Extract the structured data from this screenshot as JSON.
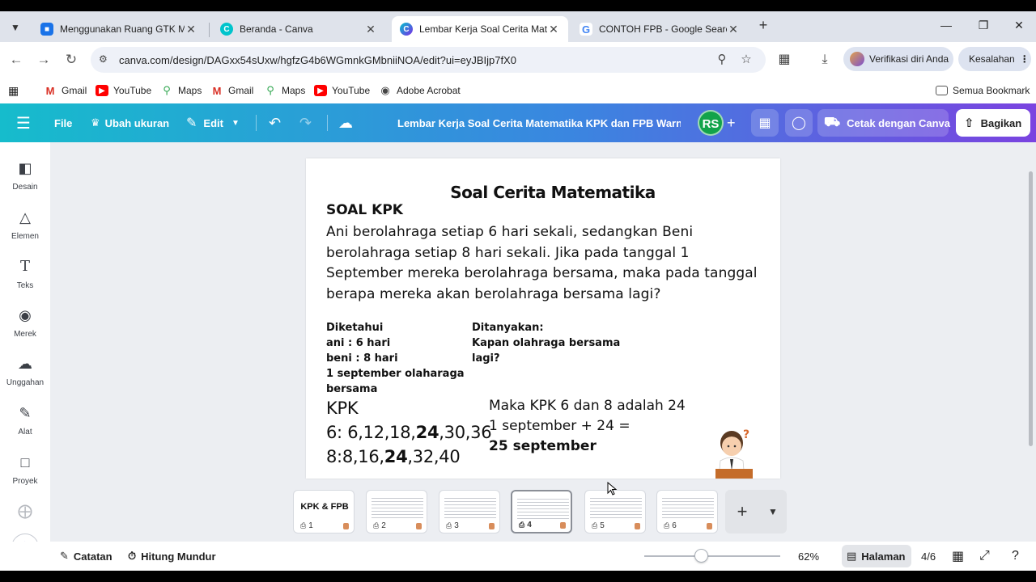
{
  "browser": {
    "tabs": [
      {
        "title": "Menggunakan Ruang GTK Mela",
        "favicon": "ruang-gtk-icon",
        "color": "#1a73e8",
        "active": false
      },
      {
        "title": "Beranda - Canva",
        "favicon": "canva-icon",
        "color": "#00c4cc",
        "active": false
      },
      {
        "title": "Lembar Kerja Soal Cerita Matem",
        "favicon": "canva-icon",
        "color": "#7d2ae8",
        "active": true
      },
      {
        "title": "CONTOH FPB - Google Search",
        "favicon": "google-icon",
        "color": "#4285f4",
        "active": false
      }
    ],
    "url": "canva.com/design/DAGxx54sUxw/hgfzG4b6WGmnkGMbniiNOA/edit?ui=eyJBIjp7fX0",
    "verify_label": "Verifikasi diri Anda",
    "error_label": "Kesalahan",
    "bookmarks": [
      {
        "label": "Gmail",
        "icon": "gmail-icon"
      },
      {
        "label": "YouTube",
        "icon": "youtube-icon"
      },
      {
        "label": "Maps",
        "icon": "maps-icon"
      },
      {
        "label": "Gmail",
        "icon": "gmail-icon"
      },
      {
        "label": "Maps",
        "icon": "maps-icon"
      },
      {
        "label": "YouTube",
        "icon": "youtube-icon"
      },
      {
        "label": "Adobe Acrobat",
        "icon": "acrobat-icon"
      }
    ],
    "all_bookmarks": "Semua Bookmark"
  },
  "canva_header": {
    "file": "File",
    "resize": "Ubah ukuran",
    "edit": "Edit",
    "doc_title": "Lembar Kerja Soal Cerita Matematika KPK dan FPB Warna H...",
    "avatar": "RS",
    "print": "Cetak dengan Canva",
    "share": "Bagikan"
  },
  "side_panel": [
    {
      "label": "Desain",
      "icon": "design-icon"
    },
    {
      "label": "Elemen",
      "icon": "elements-icon"
    },
    {
      "label": "Teks",
      "icon": "text-icon"
    },
    {
      "label": "Merek",
      "icon": "brand-icon"
    },
    {
      "label": "Unggahan",
      "icon": "upload-icon"
    },
    {
      "label": "Alat",
      "icon": "tools-icon"
    },
    {
      "label": "Proyek",
      "icon": "projects-icon"
    }
  ],
  "page": {
    "title": "Soal Cerita Matematika",
    "section": "SOAL KPK",
    "question": "Ani berolahraga setiap 6 hari sekali, sedangkan Beni berolahraga setiap 8 hari sekali. Jika pada tanggal 1 September mereka berolahraga bersama, maka pada tanggal berapa mereka akan berolahraga bersama lagi?",
    "known_title": "Diketahui",
    "known_lines": [
      "ani : 6 hari",
      "beni : 8 hari",
      "1 september olaharaga",
      "bersama"
    ],
    "asked_title": "Ditanyakan:",
    "asked_lines": [
      "Kapan olahraga bersama",
      "lagi?"
    ],
    "kpk_label": "KPK",
    "row6_prefix": "6: 6,12,18,",
    "row6_bold": "24",
    "row6_suffix": ",30,36",
    "row8_prefix": "8:8,16,",
    "row8_bold": "24",
    "row8_suffix": ",32,40",
    "answer_line1": "Maka KPK 6 dan 8 adalah 24",
    "answer_line2": "1 september + 24 =",
    "answer_line3": "25 september"
  },
  "thumbnails": {
    "first_label": "KPK & FPB",
    "pages": [
      "1",
      "2",
      "3",
      "4",
      "5",
      "6"
    ],
    "active_page": 4
  },
  "footer": {
    "notes": "Catatan",
    "timer": "Hitung Mundur",
    "zoom": "62%",
    "zoom_fraction": 0.42,
    "pages_btn": "Halaman",
    "page_count": "4/6"
  }
}
